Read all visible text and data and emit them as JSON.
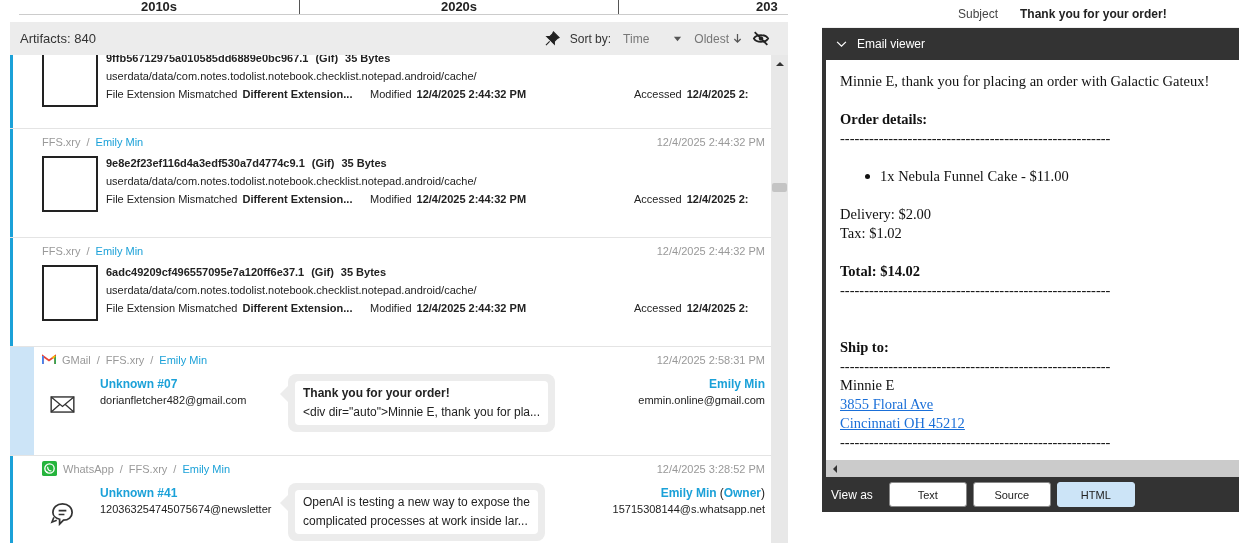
{
  "timeline": {
    "columns": [
      "2010s",
      "2020s",
      "203"
    ]
  },
  "toolbar": {
    "count_label": "Artifacts: 840",
    "sort_label": "Sort by:",
    "sort_field": "Time",
    "sort_order": "Oldest"
  },
  "artifacts": [
    {
      "kind": "file",
      "selected": false,
      "name": "9ffb56712975a010585dd6889e0bc967.1",
      "type": "(Gif)",
      "size": "35 Bytes",
      "path": "userdata/data/com.notes.todolist.notebook.checklist.notepad.android/cache/",
      "flag": "File Extension Mismatched",
      "flag_value": "Different Extension...",
      "modified_label": "Modified",
      "modified": "12/4/2025 2:44:32 PM",
      "accessed_label": "Accessed",
      "accessed": "12/4/2025 2:"
    },
    {
      "kind": "file",
      "selected": false,
      "breadcrumb": [
        {
          "kind": "source",
          "text": "FFS.xry"
        },
        {
          "kind": "owner",
          "sep": "/",
          "text": "Emily Min"
        }
      ],
      "time": "12/4/2025 2:44:32 PM",
      "name": "9e8e2f23ef116d4a3edf530a7d4774c9.1",
      "type": "(Gif)",
      "size": "35 Bytes",
      "path": "userdata/data/com.notes.todolist.notebook.checklist.notepad.android/cache/",
      "flag": "File Extension Mismatched",
      "flag_value": "Different Extension...",
      "modified_label": "Modified",
      "modified": "12/4/2025 2:44:32 PM",
      "accessed_label": "Accessed",
      "accessed": "12/4/2025 2:"
    },
    {
      "kind": "file",
      "selected": false,
      "breadcrumb": [
        {
          "kind": "source",
          "text": "FFS.xry"
        },
        {
          "kind": "owner",
          "sep": "/",
          "text": "Emily Min"
        }
      ],
      "time": "12/4/2025 2:44:32 PM",
      "name": "6adc49209cf496557095e7a120ff6e37.1",
      "type": "(Gif)",
      "size": "35 Bytes",
      "path": "userdata/data/com.notes.todolist.notebook.checklist.notepad.android/cache/",
      "flag": "File Extension Mismatched",
      "flag_value": "Different Extension...",
      "modified_label": "Modified",
      "modified": "12/4/2025 2:44:32 PM",
      "accessed_label": "Accessed",
      "accessed": "12/4/2025 2:"
    },
    {
      "kind": "email",
      "selected": true,
      "breadcrumb": [
        {
          "kind": "app",
          "text": "GMail"
        },
        {
          "kind": "source",
          "sep": "/",
          "text": "FFS.xry"
        },
        {
          "kind": "owner",
          "sep": "/",
          "text": "Emily Min"
        }
      ],
      "time": "12/4/2025 2:58:31 PM",
      "sender": "Unknown #07",
      "sender_address": "dorianfletcher482@gmail.com",
      "subject": "Thank you for your order!",
      "preview": [
        "<div dir=\"auto\">Minnie E, thank you for pla..."
      ],
      "recipient": "Emily Min",
      "recipient_address": "emmin.online@gmail.com"
    },
    {
      "kind": "chat",
      "selected": false,
      "breadcrumb": [
        {
          "kind": "app",
          "text": "WhatsApp"
        },
        {
          "kind": "source",
          "sep": "/",
          "text": "FFS.xry"
        },
        {
          "kind": "owner",
          "sep": "/",
          "text": "Emily Min"
        }
      ],
      "time": "12/4/2025 3:28:52 PM",
      "sender": "Unknown #41",
      "sender_address": "120363254745075674@newsletter",
      "preview": [
        "OpenAI is testing a new way to expose the",
        "complicated processes at work inside lar..."
      ],
      "recipient": "Emily Min",
      "recipient_role": {
        "open": "(",
        "text": "Owner",
        "close": ")"
      },
      "recipient_address": "15715308144@s.whatsapp.net"
    }
  ],
  "details": {
    "subject_label": "Subject",
    "subject": "Thank you for your order!"
  },
  "email_viewer": {
    "title": "Email viewer",
    "body": [
      {
        "kind": "text",
        "text": "Minnie E, thank you for placing an order with Galactic Gateux!"
      },
      {
        "kind": "gap"
      },
      {
        "kind": "bold",
        "text": "Order details:"
      },
      {
        "kind": "rule",
        "text": "--------------------------------------------------------"
      },
      {
        "kind": "gap"
      },
      {
        "kind": "bullet",
        "text": "1x Nebula Funnel Cake - $11.00"
      },
      {
        "kind": "gap"
      },
      {
        "kind": "text",
        "text": "Delivery: $2.00"
      },
      {
        "kind": "text",
        "text": "Tax: $1.02"
      },
      {
        "kind": "gap"
      },
      {
        "kind": "bold",
        "text": "Total: $14.02"
      },
      {
        "kind": "rule",
        "text": "--------------------------------------------------------"
      },
      {
        "kind": "gap"
      },
      {
        "kind": "gap"
      },
      {
        "kind": "bold",
        "text": "Ship to:"
      },
      {
        "kind": "rule",
        "text": "--------------------------------------------------------"
      },
      {
        "kind": "text",
        "text": "Minnie E"
      },
      {
        "kind": "link",
        "text": "3855 Floral Ave"
      },
      {
        "kind": "link",
        "text": "Cincinnati OH 45212"
      },
      {
        "kind": "rule",
        "text": "--------------------------------------------------------"
      }
    ],
    "view_label": "View as",
    "view_options": [
      {
        "label": "Text",
        "selected": false
      },
      {
        "label": "Source",
        "selected": false
      },
      {
        "label": "HTML",
        "selected": true
      }
    ]
  }
}
